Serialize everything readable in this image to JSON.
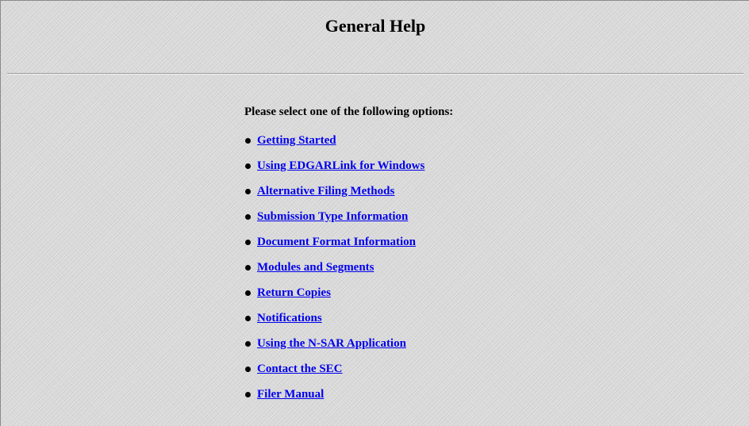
{
  "page": {
    "title": "General Help",
    "prompt": "Please select one of the following options:"
  },
  "options": [
    {
      "label": "Getting Started"
    },
    {
      "label": "Using EDGARLink for Windows"
    },
    {
      "label": "Alternative Filing Methods"
    },
    {
      "label": "Submission Type Information"
    },
    {
      "label": "Document Format Information"
    },
    {
      "label": "Modules and Segments"
    },
    {
      "label": "Return Copies"
    },
    {
      "label": "Notifications"
    },
    {
      "label": "Using the N-SAR Application"
    },
    {
      "label": "Contact the SEC"
    },
    {
      "label": "Filer Manual"
    }
  ],
  "colors": {
    "link": "#0000ee",
    "background": "#d9d9d9"
  }
}
